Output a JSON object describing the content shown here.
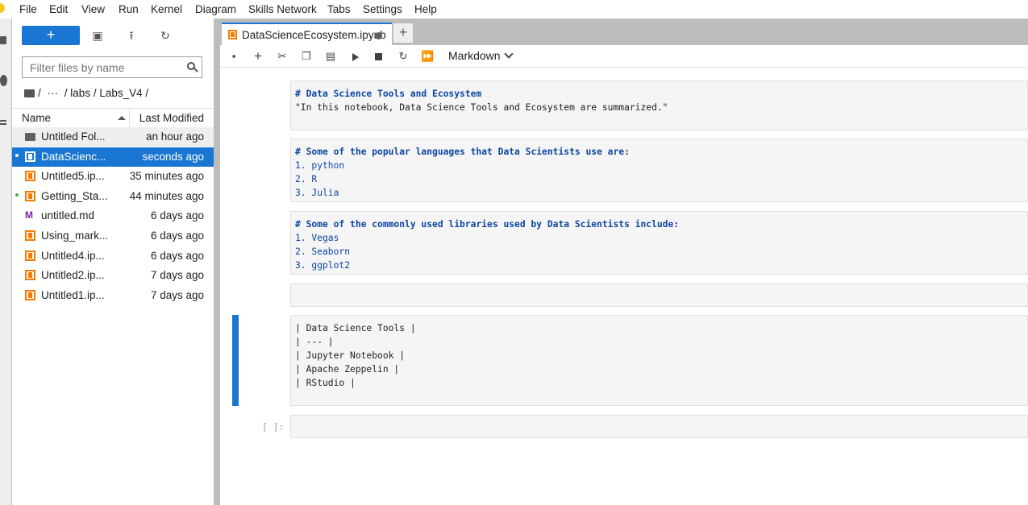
{
  "menubar": {
    "items": [
      "File",
      "Edit",
      "View",
      "Run",
      "Kernel",
      "Diagram",
      "Skills Network",
      "Tabs",
      "Settings",
      "Help"
    ]
  },
  "filebrowser": {
    "new_button_label": "+",
    "filter_placeholder": "Filter files by name",
    "breadcrumb": [
      "/",
      "···",
      "/ labs / Labs_V4 /"
    ],
    "columns": {
      "name": "Name",
      "modified": "Last Modified"
    },
    "files": [
      {
        "name": "Untitled Fol...",
        "modified": "an hour ago",
        "type": "folder",
        "running": false,
        "selected": false
      },
      {
        "name": "DataScienc...",
        "modified": "seconds ago",
        "type": "notebook",
        "running": true,
        "selected": true
      },
      {
        "name": "Untitled5.ip...",
        "modified": "35 minutes ago",
        "type": "notebook",
        "running": false,
        "selected": false
      },
      {
        "name": "Getting_Sta...",
        "modified": "44 minutes ago",
        "type": "notebook",
        "running": true,
        "selected": false
      },
      {
        "name": "untitled.md",
        "modified": "6 days ago",
        "type": "markdown",
        "running": false,
        "selected": false
      },
      {
        "name": "Using_mark...",
        "modified": "6 days ago",
        "type": "notebook",
        "running": false,
        "selected": false
      },
      {
        "name": "Untitled4.ip...",
        "modified": "6 days ago",
        "type": "notebook",
        "running": false,
        "selected": false
      },
      {
        "name": "Untitled2.ip...",
        "modified": "7 days ago",
        "type": "notebook",
        "running": false,
        "selected": false
      },
      {
        "name": "Untitled1.ip...",
        "modified": "7 days ago",
        "type": "notebook",
        "running": false,
        "selected": false
      }
    ]
  },
  "tabs": {
    "active_label": "DataScienceEcosystem.ipynb",
    "add_label": "+"
  },
  "toolbar": {
    "cell_type": "Markdown"
  },
  "notebook": {
    "cells": [
      {
        "lines": [
          {
            "text": "# Data Science Tools and Ecosystem",
            "style": "hdr"
          },
          {
            "text": "\"In this notebook, Data Science Tools and Ecosystem are summarized.\"",
            "style": "str"
          }
        ]
      },
      {
        "lines": [
          {
            "text": "# Some of the popular languages that Data Scientists use are:",
            "style": "hdr"
          },
          {
            "text": "1. python",
            "style": "lst"
          },
          {
            "text": "2. R",
            "style": "lst"
          },
          {
            "text": "3. Julia",
            "style": "lst"
          }
        ]
      },
      {
        "lines": [
          {
            "text": "# Some of the commonly used libraries used by Data Scientists include:",
            "style": "hdr"
          },
          {
            "text": "1. Vegas",
            "style": "lst"
          },
          {
            "text": "2. Seaborn",
            "style": "lst"
          },
          {
            "text": "3. ggplot2",
            "style": "lst"
          }
        ]
      },
      {
        "lines": []
      },
      {
        "lines": [
          {
            "text": "| Data Science Tools |",
            "style": "tbl"
          },
          {
            "text": "| --- |",
            "style": "tbl"
          },
          {
            "text": "| Jupyter Notebook |",
            "style": "tbl"
          },
          {
            "text": "| Apache Zeppelin |",
            "style": "tbl"
          },
          {
            "text": "| RStudio |",
            "style": "tbl"
          }
        ]
      },
      {
        "lines": []
      }
    ],
    "code_prompt": "[ ]:"
  },
  "colors": {
    "accent": "#1976d2",
    "notebook_icon": "#f57c00",
    "markdown_icon": "#7b1fa2",
    "heading_text": "#0d47a1",
    "running_dot": "#4caf50"
  }
}
